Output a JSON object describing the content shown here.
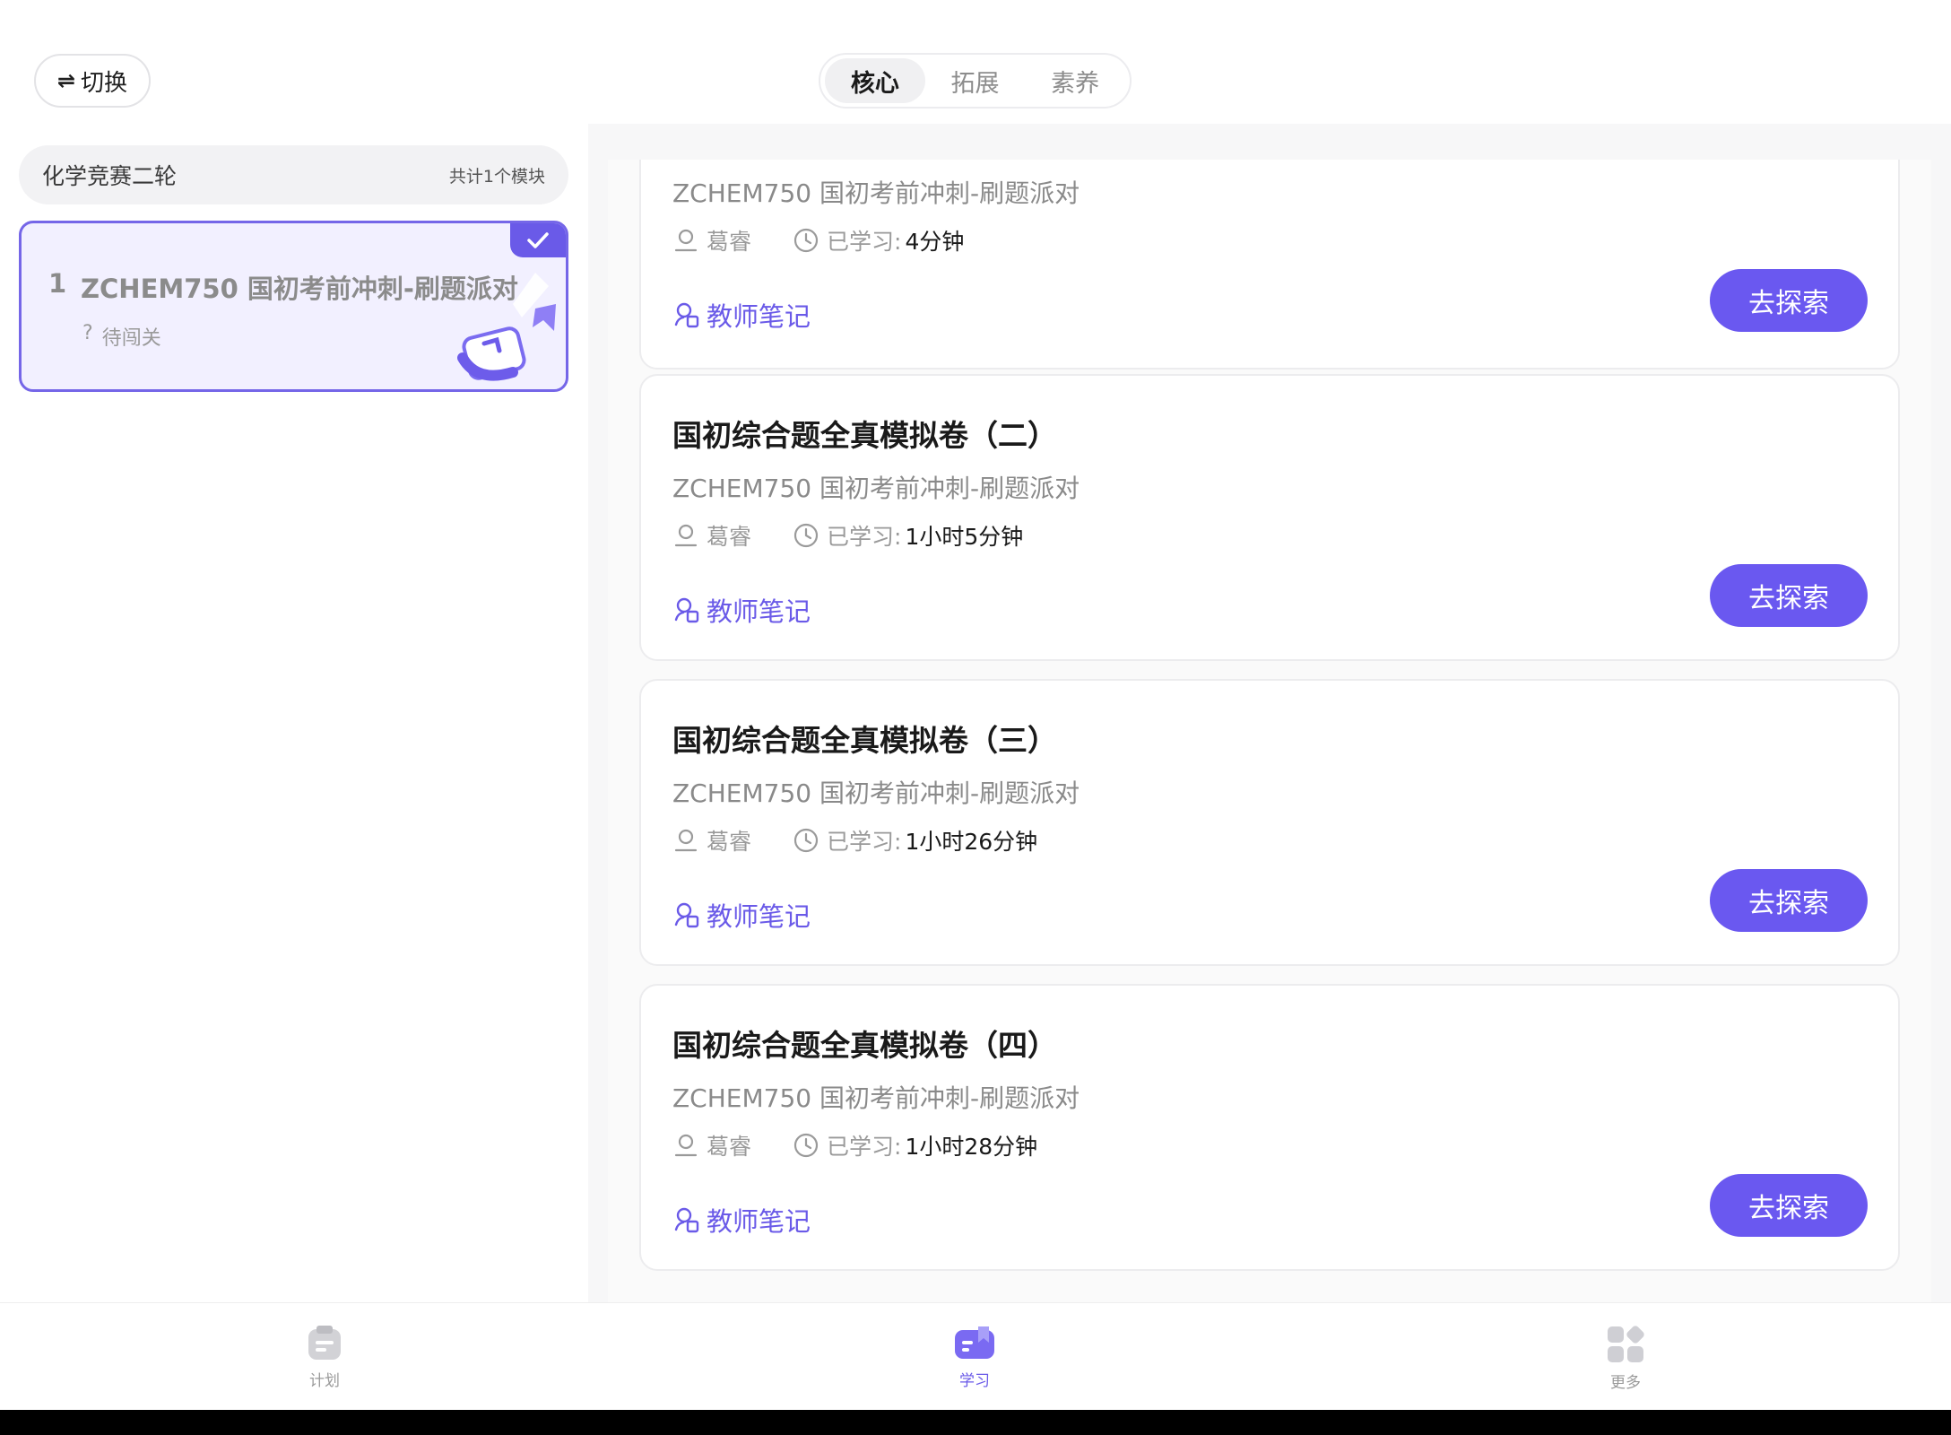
{
  "header": {
    "switch_label": "切换",
    "tabs": [
      "核心",
      "拓展",
      "素养"
    ],
    "active_tab": "核心"
  },
  "sidebar": {
    "course_title": "化学竞赛二轮",
    "module_count": "共计1个模块",
    "modules": [
      {
        "index": "1",
        "title": "ZCHEM750 国初考前冲刺-刷题派对",
        "status": "待闯关",
        "status_icon": "?"
      }
    ]
  },
  "cards": [
    {
      "title": "",
      "subtitle": "ZCHEM750 国初考前冲刺-刷题派对",
      "teacher": "葛睿",
      "studied_label": "已学习:",
      "duration": "4分钟",
      "notes": "教师笔记",
      "button": "去探索"
    },
    {
      "title": "国初综合题全真模拟卷（二）",
      "subtitle": "ZCHEM750 国初考前冲刺-刷题派对",
      "teacher": "葛睿",
      "studied_label": "已学习:",
      "duration": "1小时5分钟",
      "notes": "教师笔记",
      "button": "去探索"
    },
    {
      "title": "国初综合题全真模拟卷（三）",
      "subtitle": "ZCHEM750 国初考前冲刺-刷题派对",
      "teacher": "葛睿",
      "studied_label": "已学习:",
      "duration": "1小时26分钟",
      "notes": "教师笔记",
      "button": "去探索"
    },
    {
      "title": "国初综合题全真模拟卷（四）",
      "subtitle": "ZCHEM750 国初考前冲刺-刷题派对",
      "teacher": "葛睿",
      "studied_label": "已学习:",
      "duration": "1小时28分钟",
      "notes": "教师笔记",
      "button": "去探索"
    }
  ],
  "bottom_nav": {
    "items": [
      {
        "label": "计划",
        "icon": "plan-icon"
      },
      {
        "label": "学习",
        "icon": "study-icon"
      },
      {
        "label": "更多",
        "icon": "more-icon"
      }
    ],
    "active": "学习"
  },
  "colors": {
    "accent": "#6a58f0",
    "accent_light": "#f2f0ff",
    "text_primary": "#1a1a1a",
    "text_secondary": "#8a8a8a"
  }
}
